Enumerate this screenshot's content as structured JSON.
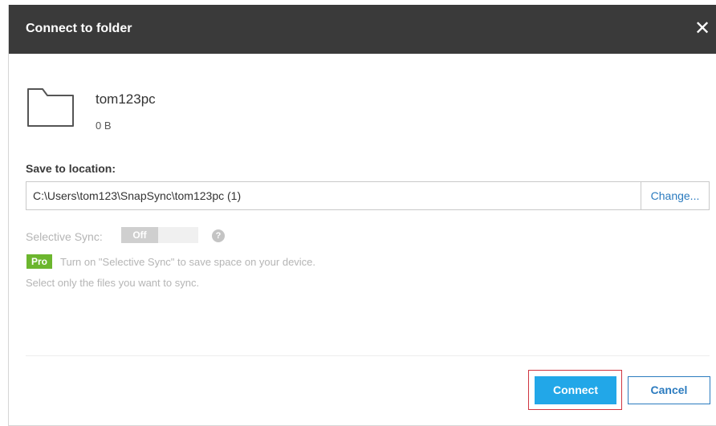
{
  "dialog": {
    "title": "Connect to folder",
    "close_glyph": "✕"
  },
  "folder": {
    "icon": "folder-icon",
    "name": "tom123pc",
    "size": "0 B"
  },
  "save_location": {
    "label": "Save to location:",
    "path": "C:\\Users\\tom123\\SnapSync\\tom123pc (1)",
    "change_label": "Change..."
  },
  "selective_sync": {
    "label": "Selective Sync:",
    "toggle_state": "Off",
    "help_glyph": "?",
    "pro_badge": "Pro",
    "pro_text": "Turn on \"Selective Sync\" to save space on your device.",
    "pro_text_2": "Select only the files you want to sync."
  },
  "footer": {
    "connect_label": "Connect",
    "cancel_label": "Cancel"
  },
  "colors": {
    "titlebar": "#3a3a3a",
    "primary": "#22a7e8",
    "link": "#2b7bbf",
    "pro": "#6cb62e",
    "highlight_border": "#d0343f"
  }
}
